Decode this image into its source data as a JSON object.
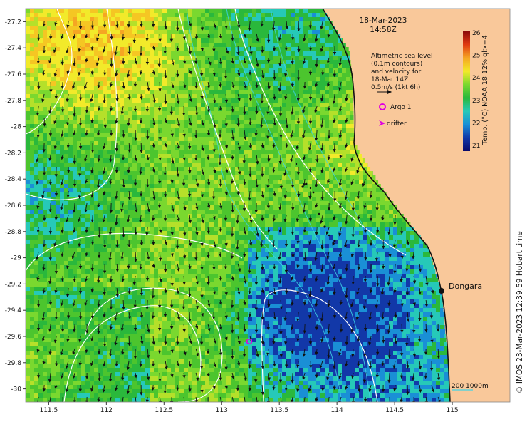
{
  "header": {
    "date": "18-Mar-2023",
    "time": "14:58Z"
  },
  "legend": {
    "sea_level_lines": [
      "Altimetric sea level",
      "(0.1m contours)",
      "and velocity for",
      "18-Mar 14Z",
      "0.5m/s (1kt 6h)"
    ],
    "argo_label": "Argo 1",
    "drifter_label": "drifter",
    "argo_icon": "circle-marker",
    "drifter_icon": "arrow-marker",
    "marker_color": "#e000e0"
  },
  "colorbar": {
    "label": "Temp. (°C) NOAA 18 12% ql>=4",
    "ticks": [
      "26",
      "25",
      "24",
      "23",
      "22",
      "21"
    ],
    "stops": [
      "#8c0a0a",
      "#e03a10",
      "#f5a623",
      "#f2ea2a",
      "#7ad82f",
      "#2ab83c",
      "#26c9b8",
      "#1a8fd6",
      "#1238a8",
      "#0a0a6a"
    ]
  },
  "place": {
    "name": "Dongara"
  },
  "scale_bar": {
    "label": "200  1000m"
  },
  "copyright": "© IMOS 23-Mar-2023 12:39:59 Hobart time",
  "colors": {
    "land": "#f9c89a",
    "coast": "#111111",
    "contour": "#ffffff",
    "current_arrow": "#111111",
    "bathymetry": "#3fd4e6"
  },
  "chart_data": {
    "type": "heatmap",
    "title": "18-Mar-2023 14:58Z",
    "xlabel": "",
    "ylabel": "",
    "x_ticks": [
      "111.5",
      "112",
      "112.5",
      "113",
      "113.5",
      "114",
      "114.5",
      "115"
    ],
    "y_ticks": [
      "-27.2",
      "-27.4",
      "-27.6",
      "-27.8",
      "-28",
      "-28.2",
      "-28.4",
      "-28.6",
      "-28.8",
      "-29",
      "-29.2",
      "-29.4",
      "-29.6",
      "-29.8",
      "-30"
    ],
    "xlim": [
      111.3,
      115.5
    ],
    "ylim": [
      -30.1,
      -27.1
    ],
    "value_range": [
      20.5,
      26
    ],
    "units": "°C",
    "argo_float": {
      "lon": 113.25,
      "lat": -29.64
    },
    "place_point": {
      "name": "Dongara",
      "lon": 114.92,
      "lat": -29.25
    }
  }
}
